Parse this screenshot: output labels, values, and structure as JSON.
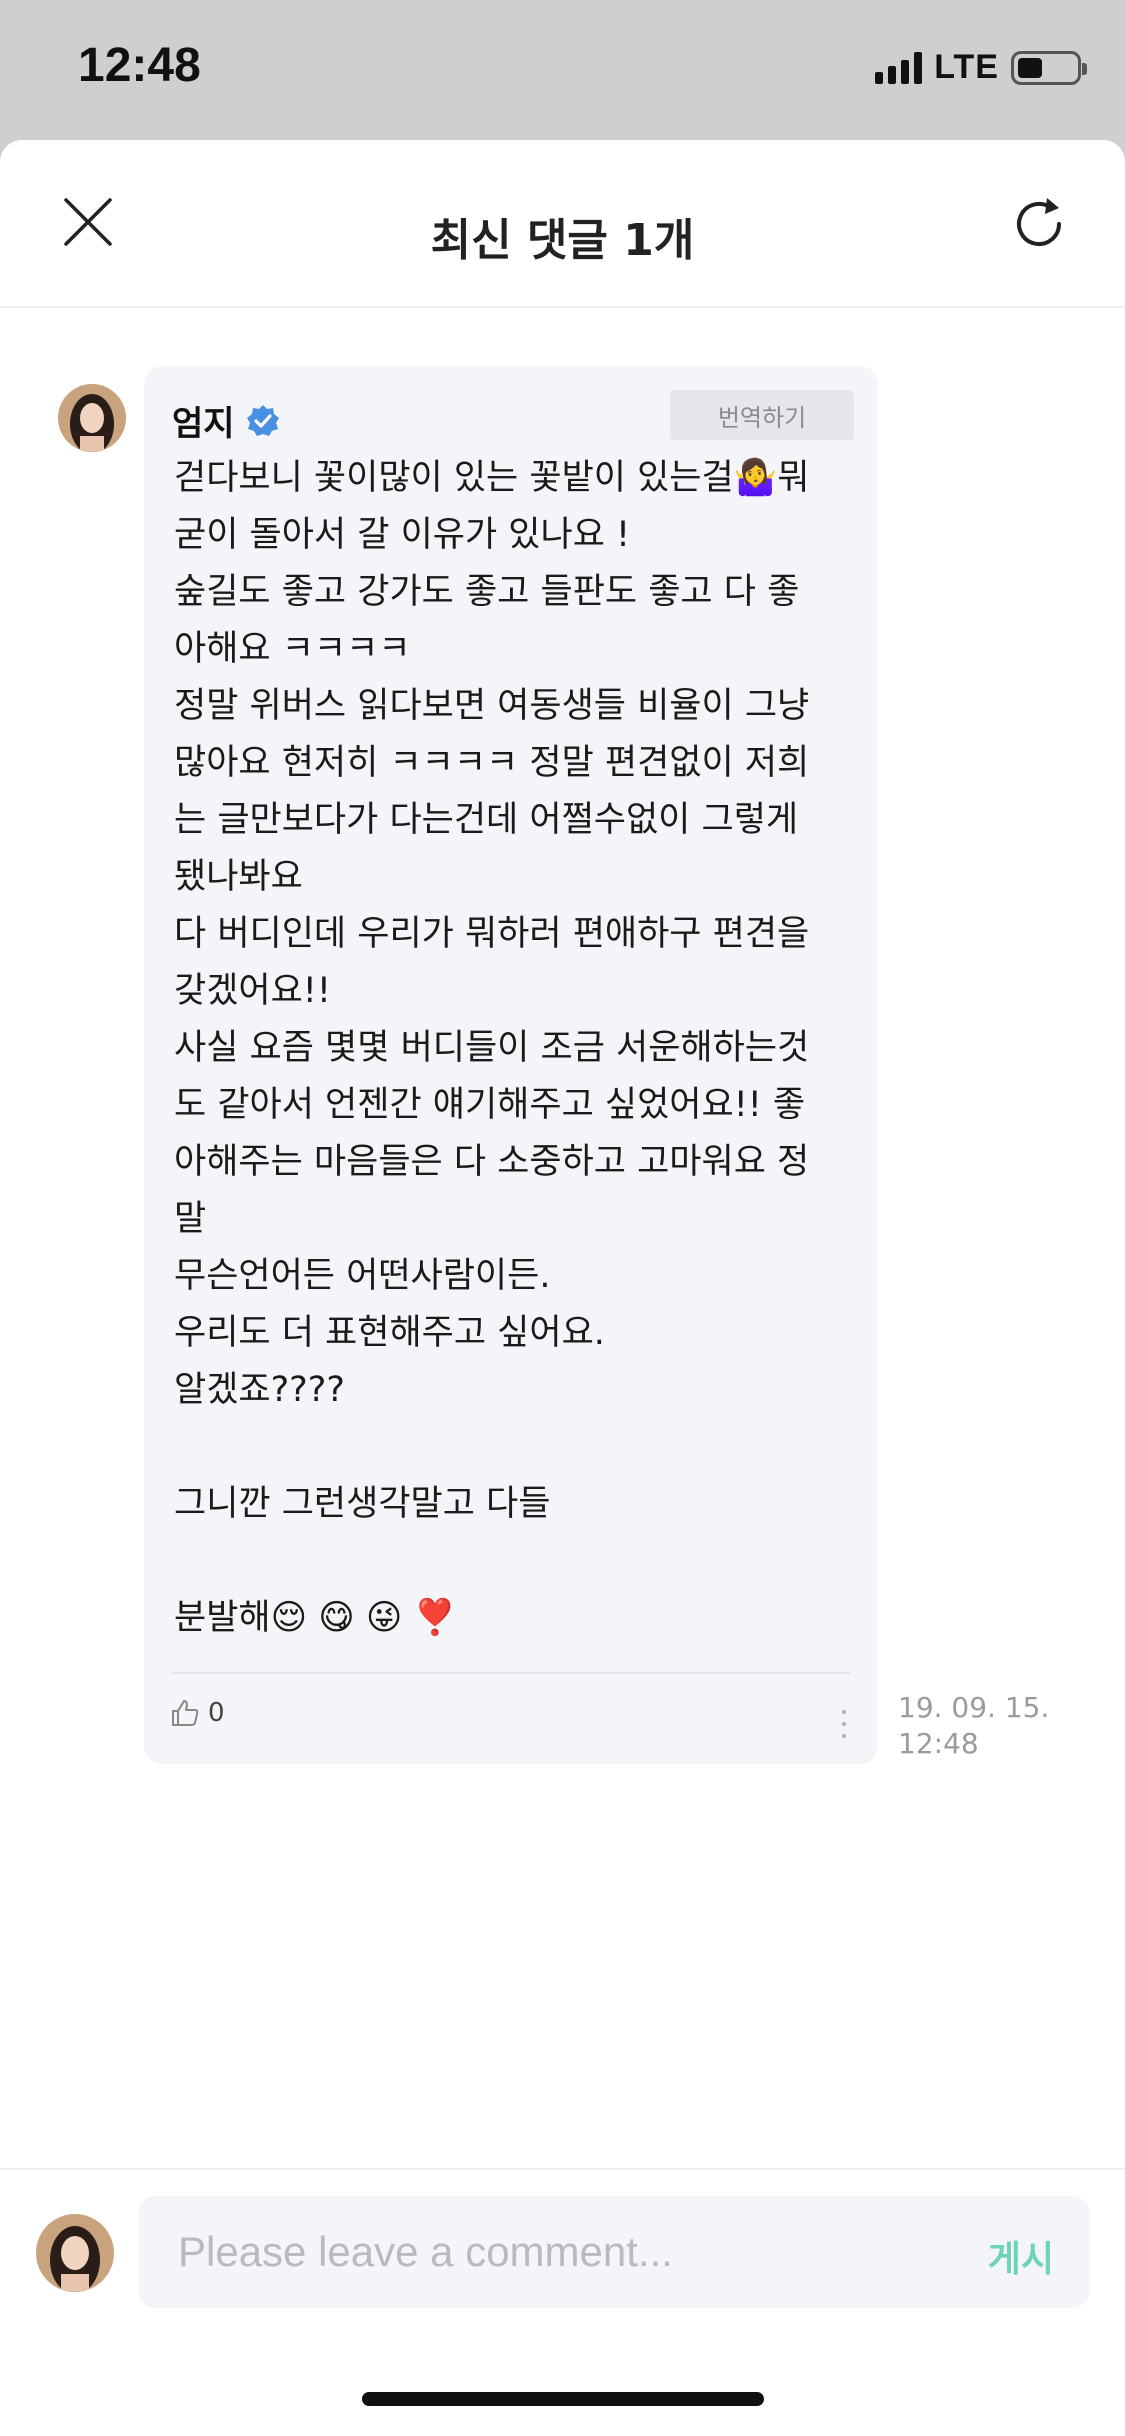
{
  "status_bar": {
    "time": "12:48",
    "network": "LTE",
    "battery_level": 0.35
  },
  "header": {
    "title": "최신 댓글 1개",
    "close_icon": "close-icon",
    "refresh_icon": "refresh-icon"
  },
  "comment": {
    "author": "엄지",
    "verified": true,
    "translate_label": "번역하기",
    "text": "걷다보니 꽃이많이 있는 꽃밭이 있는걸🤷‍♀️뭐\n굳이 돌아서 갈 이유가 있나요 !\n숲길도 좋고 강가도 좋고 들판도 좋고 다 좋\n아해요 ㅋㅋㅋㅋ\n정말 위버스 읽다보면 여동생들 비율이 그냥\n많아요 현저히 ㅋㅋㅋㅋ 정말 편견없이 저희\n는 글만보다가 다는건데 어쩔수없이 그렇게\n됐나봐요\n다 버디인데 우리가 뭐하러 편애하구 편견을\n갖겠어요!!\n사실 요즘 몇몇 버디들이 조금 서운해하는것\n도 같아서 언젠간 얘기해주고 싶었어요!! 좋\n아해주는 마음들은 다 소중하고 고마워요 정\n말\n무슨언어든 어떤사람이든.\n우리도 더 표현해주고 싶어요.\n알겠죠????\n\n그니깐 그런생각말고 다들\n\n분발해😌 😋 😜 ❣️",
    "likes": "0",
    "timestamp": "19. 09. 15.\n12:48"
  },
  "input": {
    "placeholder": "Please leave a comment...",
    "value": "",
    "post_label": "게시"
  },
  "colors": {
    "accent": "#6fd3b8",
    "verified": "#4a90e2",
    "bubble_bg": "#f4f5f9"
  }
}
